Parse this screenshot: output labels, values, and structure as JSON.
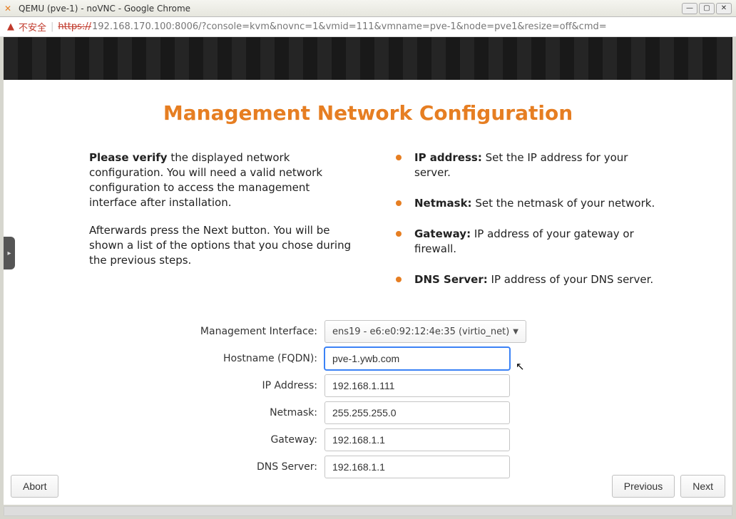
{
  "window": {
    "title": "QEMU (pve-1) - noVNC - Google Chrome"
  },
  "addressbar": {
    "warn_text": "不安全",
    "protocol_strike": "https://",
    "url_rest": "192.168.170.100:8006/?console=kvm&novnc=1&vmid=111&vmname=pve-1&node=pve1&resize=off&cmd="
  },
  "page": {
    "title": "Management Network Configuration"
  },
  "left_text": {
    "p1_bold": "Please verify",
    "p1_rest": " the displayed network configuration. You will need a valid network configuration to access the management interface after installation.",
    "p2": "Afterwards press the Next button. You will be shown a list of the options that you chose during the previous steps."
  },
  "bullets": [
    {
      "label": "IP address:",
      "text": " Set the IP address for your server."
    },
    {
      "label": "Netmask:",
      "text": " Set the netmask of your network."
    },
    {
      "label": "Gateway:",
      "text": " IP address of your gateway or firewall."
    },
    {
      "label": "DNS Server:",
      "text": " IP address of your DNS server."
    }
  ],
  "form": {
    "mgmt_iface_label": "Management Interface:",
    "mgmt_iface_value": "ens19 - e6:e0:92:12:4e:35 (virtio_net)",
    "hostname_label": "Hostname (FQDN):",
    "hostname_value": "pve-1.ywb.com",
    "ip_label": "IP Address:",
    "ip_value": "192.168.1.111",
    "netmask_label": "Netmask:",
    "netmask_value": "255.255.255.0",
    "gateway_label": "Gateway:",
    "gateway_value": "192.168.1.1",
    "dns_label": "DNS Server:",
    "dns_value": "192.168.1.1"
  },
  "footer": {
    "abort": "Abort",
    "previous": "Previous",
    "next": "Next"
  }
}
